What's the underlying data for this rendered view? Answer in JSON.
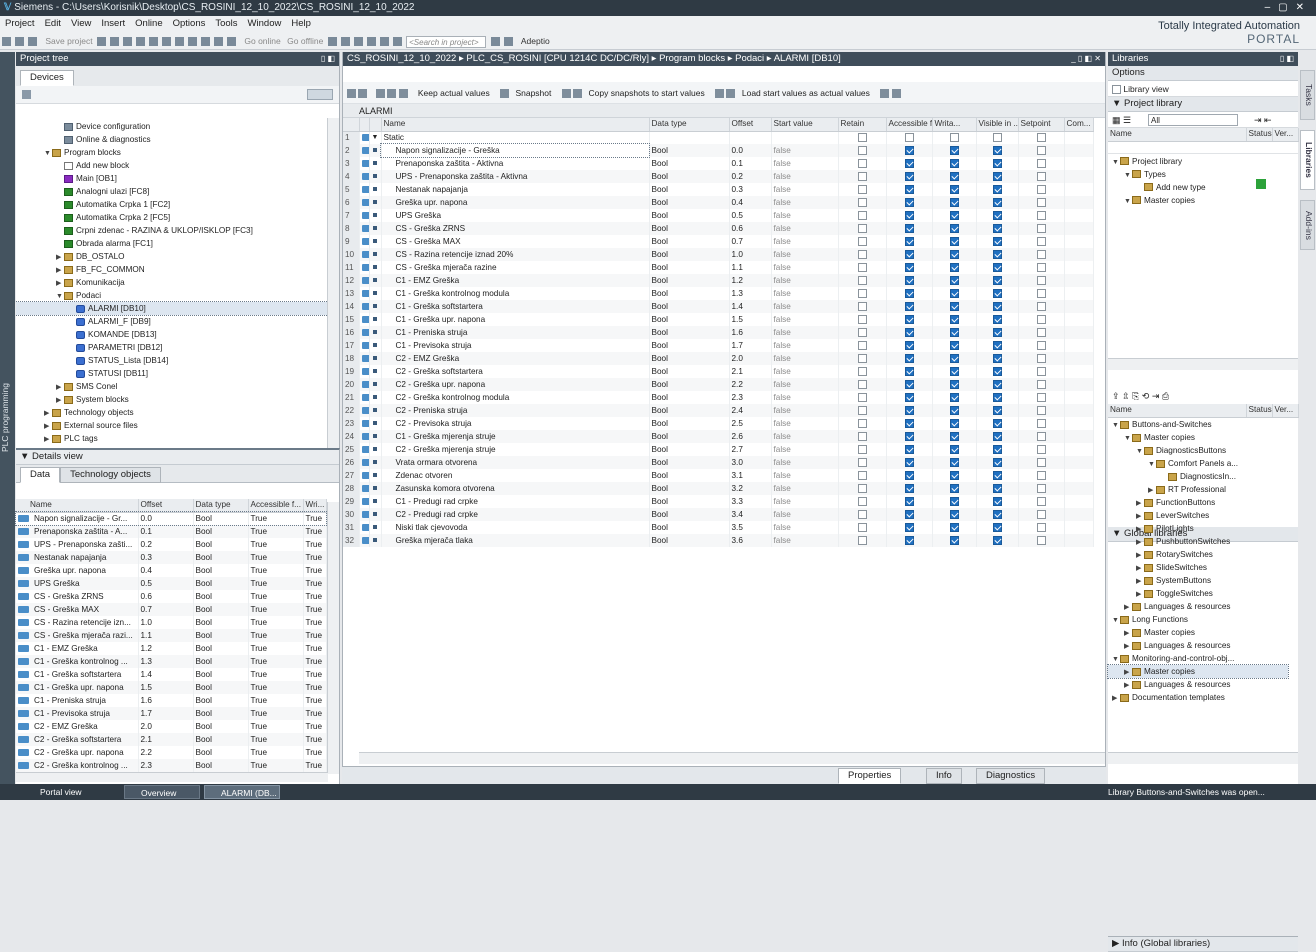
{
  "window": {
    "title": "Siemens - C:\\Users\\Korisnik\\Desktop\\CS_ROSINI_12_10_2022\\CS_ROSINI_12_10_2022"
  },
  "menu": [
    "Project",
    "Edit",
    "View",
    "Insert",
    "Online",
    "Options",
    "Tools",
    "Window",
    "Help"
  ],
  "toolbar": {
    "save_project": "Save project",
    "go_online": "Go online",
    "go_offline": "Go offline",
    "search_placeholder": "<Search in project>",
    "adeptio": "Adeptio"
  },
  "branding": {
    "line1": "Totally Integrated Automation",
    "line2": "PORTAL"
  },
  "left_tab": "PLC programming",
  "project_tree": {
    "title": "Project tree",
    "devices_tab": "Devices",
    "items": [
      {
        "label": "Device configuration",
        "indent": 3,
        "icon": "dev",
        "tw": ""
      },
      {
        "label": "Online & diagnostics",
        "indent": 3,
        "icon": "dev",
        "tw": ""
      },
      {
        "label": "Program blocks",
        "indent": 2,
        "icon": "fold",
        "tw": "▼"
      },
      {
        "label": "Add new block",
        "indent": 3,
        "icon": "add",
        "tw": ""
      },
      {
        "label": "Main [OB1]",
        "indent": 3,
        "icon": "ob",
        "tw": ""
      },
      {
        "label": "Analogni ulazi [FC8]",
        "indent": 3,
        "icon": "fc",
        "tw": ""
      },
      {
        "label": "Automatika Crpka 1 [FC2]",
        "indent": 3,
        "icon": "fc",
        "tw": ""
      },
      {
        "label": "Automatika Crpka 2 [FC5]",
        "indent": 3,
        "icon": "fc",
        "tw": ""
      },
      {
        "label": "Crpni zdenac - RAZINA & UKLOP/ISKLOP [FC3]",
        "indent": 3,
        "icon": "fc",
        "tw": ""
      },
      {
        "label": "Obrada alarma [FC1]",
        "indent": 3,
        "icon": "fc",
        "tw": ""
      },
      {
        "label": "DB_OSTALO",
        "indent": 3,
        "icon": "fold",
        "tw": "▶"
      },
      {
        "label": "FB_FC_COMMON",
        "indent": 3,
        "icon": "fold",
        "tw": "▶"
      },
      {
        "label": "Komunikacija",
        "indent": 3,
        "icon": "fold",
        "tw": "▶"
      },
      {
        "label": "Podaci",
        "indent": 3,
        "icon": "fold",
        "tw": "▼"
      },
      {
        "label": "ALARMI [DB10]",
        "indent": 4,
        "icon": "db",
        "tw": "",
        "sel": true
      },
      {
        "label": "ALARMI_F [DB9]",
        "indent": 4,
        "icon": "db",
        "tw": ""
      },
      {
        "label": "KOMANDE [DB13]",
        "indent": 4,
        "icon": "db",
        "tw": ""
      },
      {
        "label": "PARAMETRI [DB12]",
        "indent": 4,
        "icon": "db",
        "tw": ""
      },
      {
        "label": "STATUS_Lista [DB14]",
        "indent": 4,
        "icon": "db",
        "tw": ""
      },
      {
        "label": "STATUSI [DB11]",
        "indent": 4,
        "icon": "db",
        "tw": ""
      },
      {
        "label": "SMS Conel",
        "indent": 3,
        "icon": "fold",
        "tw": "▶"
      },
      {
        "label": "System blocks",
        "indent": 3,
        "icon": "fold",
        "tw": "▶"
      },
      {
        "label": "Technology objects",
        "indent": 2,
        "icon": "fold",
        "tw": "▶"
      },
      {
        "label": "External source files",
        "indent": 2,
        "icon": "fold",
        "tw": "▶"
      },
      {
        "label": "PLC tags",
        "indent": 2,
        "icon": "fold",
        "tw": "▶"
      }
    ]
  },
  "details": {
    "title": "Details view",
    "tab_data": "Data",
    "tab_tech": "Technology objects",
    "columns": [
      "Name",
      "Offset",
      "Data type",
      "Accessible f...",
      "Wri..."
    ],
    "rows": [
      [
        "Napon signalizacije - Gr...",
        "0.0",
        "Bool",
        "True",
        "True"
      ],
      [
        "Prenaponska zaštita - A...",
        "0.1",
        "Bool",
        "True",
        "True"
      ],
      [
        "UPS - Prenaponska zašti...",
        "0.2",
        "Bool",
        "True",
        "True"
      ],
      [
        "Nestanak napajanja",
        "0.3",
        "Bool",
        "True",
        "True"
      ],
      [
        "Greška upr. napona",
        "0.4",
        "Bool",
        "True",
        "True"
      ],
      [
        "UPS Greška",
        "0.5",
        "Bool",
        "True",
        "True"
      ],
      [
        "CS - Greška ZRNS",
        "0.6",
        "Bool",
        "True",
        "True"
      ],
      [
        "CS - Greška MAX",
        "0.7",
        "Bool",
        "True",
        "True"
      ],
      [
        "CS - Razina retencije izn...",
        "1.0",
        "Bool",
        "True",
        "True"
      ],
      [
        "CS - Greška mjerača razi...",
        "1.1",
        "Bool",
        "True",
        "True"
      ],
      [
        "C1 - EMZ Greška",
        "1.2",
        "Bool",
        "True",
        "True"
      ],
      [
        "C1 - Greška kontrolnog ...",
        "1.3",
        "Bool",
        "True",
        "True"
      ],
      [
        "C1 - Greška softstartera",
        "1.4",
        "Bool",
        "True",
        "True"
      ],
      [
        "C1 - Greška upr. napona",
        "1.5",
        "Bool",
        "True",
        "True"
      ],
      [
        "C1 - Preniska struja",
        "1.6",
        "Bool",
        "True",
        "True"
      ],
      [
        "C1 - Previsoka struja",
        "1.7",
        "Bool",
        "True",
        "True"
      ],
      [
        "C2 - EMZ Greška",
        "2.0",
        "Bool",
        "True",
        "True"
      ],
      [
        "C2 - Greška softstartera",
        "2.1",
        "Bool",
        "True",
        "True"
      ],
      [
        "C2 - Greška upr. napona",
        "2.2",
        "Bool",
        "True",
        "True"
      ],
      [
        "C2 - Greška kontrolnog ...",
        "2.3",
        "Bool",
        "True",
        "True"
      ]
    ]
  },
  "editor": {
    "breadcrumb": "CS_ROSINI_12_10_2022 ▸ PLC_CS_ROSINI [CPU 1214C DC/DC/Rly] ▸ Program blocks ▸ Podaci ▸ ALARMI [DB10]",
    "toolbar": {
      "keep_actual": "Keep actual values",
      "snapshot": "Snapshot",
      "copy_snapshots": "Copy snapshots to start values",
      "load_start": "Load start values as actual values"
    },
    "block_name": "ALARMI",
    "columns": [
      "Name",
      "Data type",
      "Offset",
      "Start value",
      "Retain",
      "Accessible f...",
      "Writa...",
      "Visible in ...",
      "Setpoint",
      "Com..."
    ],
    "static_label": "Static",
    "rows": [
      [
        "Napon signalizacije - Greška",
        "Bool",
        "0.0",
        "false"
      ],
      [
        "Prenaponska zaštita - Aktivna",
        "Bool",
        "0.1",
        "false"
      ],
      [
        "UPS - Prenaponska zaštita - Aktivna",
        "Bool",
        "0.2",
        "false"
      ],
      [
        "Nestanak napajanja",
        "Bool",
        "0.3",
        "false"
      ],
      [
        "Greška upr. napona",
        "Bool",
        "0.4",
        "false"
      ],
      [
        "UPS Greška",
        "Bool",
        "0.5",
        "false"
      ],
      [
        "CS - Greška ZRNS",
        "Bool",
        "0.6",
        "false"
      ],
      [
        "CS - Greška MAX",
        "Bool",
        "0.7",
        "false"
      ],
      [
        "CS - Razina retencije iznad 20%",
        "Bool",
        "1.0",
        "false"
      ],
      [
        "CS - Greška mjerača razine",
        "Bool",
        "1.1",
        "false"
      ],
      [
        "C1 - EMZ Greška",
        "Bool",
        "1.2",
        "false"
      ],
      [
        "C1 - Greška kontrolnog modula",
        "Bool",
        "1.3",
        "false"
      ],
      [
        "C1 - Greška softstartera",
        "Bool",
        "1.4",
        "false"
      ],
      [
        "C1 - Greška upr. napona",
        "Bool",
        "1.5",
        "false"
      ],
      [
        "C1 - Preniska struja",
        "Bool",
        "1.6",
        "false"
      ],
      [
        "C1 - Previsoka struja",
        "Bool",
        "1.7",
        "false"
      ],
      [
        "C2 - EMZ Greška",
        "Bool",
        "2.0",
        "false"
      ],
      [
        "C2 - Greška softstartera",
        "Bool",
        "2.1",
        "false"
      ],
      [
        "C2 - Greška upr. napona",
        "Bool",
        "2.2",
        "false"
      ],
      [
        "C2 - Greška kontrolnog modula",
        "Bool",
        "2.3",
        "false"
      ],
      [
        "C2 - Preniska struja",
        "Bool",
        "2.4",
        "false"
      ],
      [
        "C2 - Previsoka struja",
        "Bool",
        "2.5",
        "false"
      ],
      [
        "C1 - Greška mjerenja struje",
        "Bool",
        "2.6",
        "false"
      ],
      [
        "C2 - Greška mjerenja struje",
        "Bool",
        "2.7",
        "false"
      ],
      [
        "Vrata ormara otvorena",
        "Bool",
        "3.0",
        "false"
      ],
      [
        "Zdenac otvoren",
        "Bool",
        "3.1",
        "false"
      ],
      [
        "Zasunska komora otvorena",
        "Bool",
        "3.2",
        "false"
      ],
      [
        "C1 - Predugi rad crpke",
        "Bool",
        "3.3",
        "false"
      ],
      [
        "C2 - Predugi rad crpke",
        "Bool",
        "3.4",
        "false"
      ],
      [
        "Niski tlak cjevovoda",
        "Bool",
        "3.5",
        "false"
      ],
      [
        "Greška mjerača tlaka",
        "Bool",
        "3.6",
        "false"
      ]
    ]
  },
  "inspector": {
    "properties": "Properties",
    "info": "Info",
    "diagnostics": "Diagnostics"
  },
  "libraries": {
    "title": "Libraries",
    "options": "Options",
    "library_view": "Library view",
    "project_library": "Project library",
    "filter": "All",
    "col_name": "Name",
    "col_status": "Status",
    "col_ver": "Ver...",
    "proj_items": [
      {
        "label": "Project library",
        "indent": 0,
        "tw": "▼"
      },
      {
        "label": "Types",
        "indent": 1,
        "tw": "▼"
      },
      {
        "label": "Add new type",
        "indent": 2,
        "tw": ""
      },
      {
        "label": "Master copies",
        "indent": 1,
        "tw": "▼"
      }
    ],
    "global_title": "Global libraries",
    "global_items": [
      {
        "label": "Buttons-and-Switches",
        "indent": 0,
        "tw": "▼"
      },
      {
        "label": "Master copies",
        "indent": 1,
        "tw": "▼"
      },
      {
        "label": "DiagnosticsButtons",
        "indent": 2,
        "tw": "▼"
      },
      {
        "label": "Comfort Panels a...",
        "indent": 3,
        "tw": "▼"
      },
      {
        "label": "DiagnosticsIn...",
        "indent": 4,
        "tw": ""
      },
      {
        "label": "RT Professional",
        "indent": 3,
        "tw": "▶"
      },
      {
        "label": "FunctionButtons",
        "indent": 2,
        "tw": "▶"
      },
      {
        "label": "LeverSwitches",
        "indent": 2,
        "tw": "▶"
      },
      {
        "label": "PilotLights",
        "indent": 2,
        "tw": "▶"
      },
      {
        "label": "PushbuttonSwitches",
        "indent": 2,
        "tw": "▶"
      },
      {
        "label": "RotarySwitches",
        "indent": 2,
        "tw": "▶"
      },
      {
        "label": "SlideSwitches",
        "indent": 2,
        "tw": "▶"
      },
      {
        "label": "SystemButtons",
        "indent": 2,
        "tw": "▶"
      },
      {
        "label": "ToggleSwitches",
        "indent": 2,
        "tw": "▶"
      },
      {
        "label": "Languages & resources",
        "indent": 1,
        "tw": "▶"
      },
      {
        "label": "Long Functions",
        "indent": 0,
        "tw": "▼"
      },
      {
        "label": "Master copies",
        "indent": 1,
        "tw": "▶"
      },
      {
        "label": "Languages & resources",
        "indent": 1,
        "tw": "▶"
      },
      {
        "label": "Monitoring-and-control-obj...",
        "indent": 0,
        "tw": "▼"
      },
      {
        "label": "Master copies",
        "indent": 1,
        "tw": "▶"
      },
      {
        "label": "Languages & resources",
        "indent": 1,
        "tw": "▶"
      },
      {
        "label": "Documentation templates",
        "indent": 0,
        "tw": "▶"
      }
    ],
    "info_global": "Info (Global libraries)"
  },
  "right_tabs": [
    "Tasks",
    "Libraries",
    "Add-ins"
  ],
  "statusbar": {
    "portal_view": "Portal view",
    "overview": "Overview",
    "alarmi": "ALARMI (DB...",
    "message": "Library Buttons-and-Switches was open..."
  }
}
